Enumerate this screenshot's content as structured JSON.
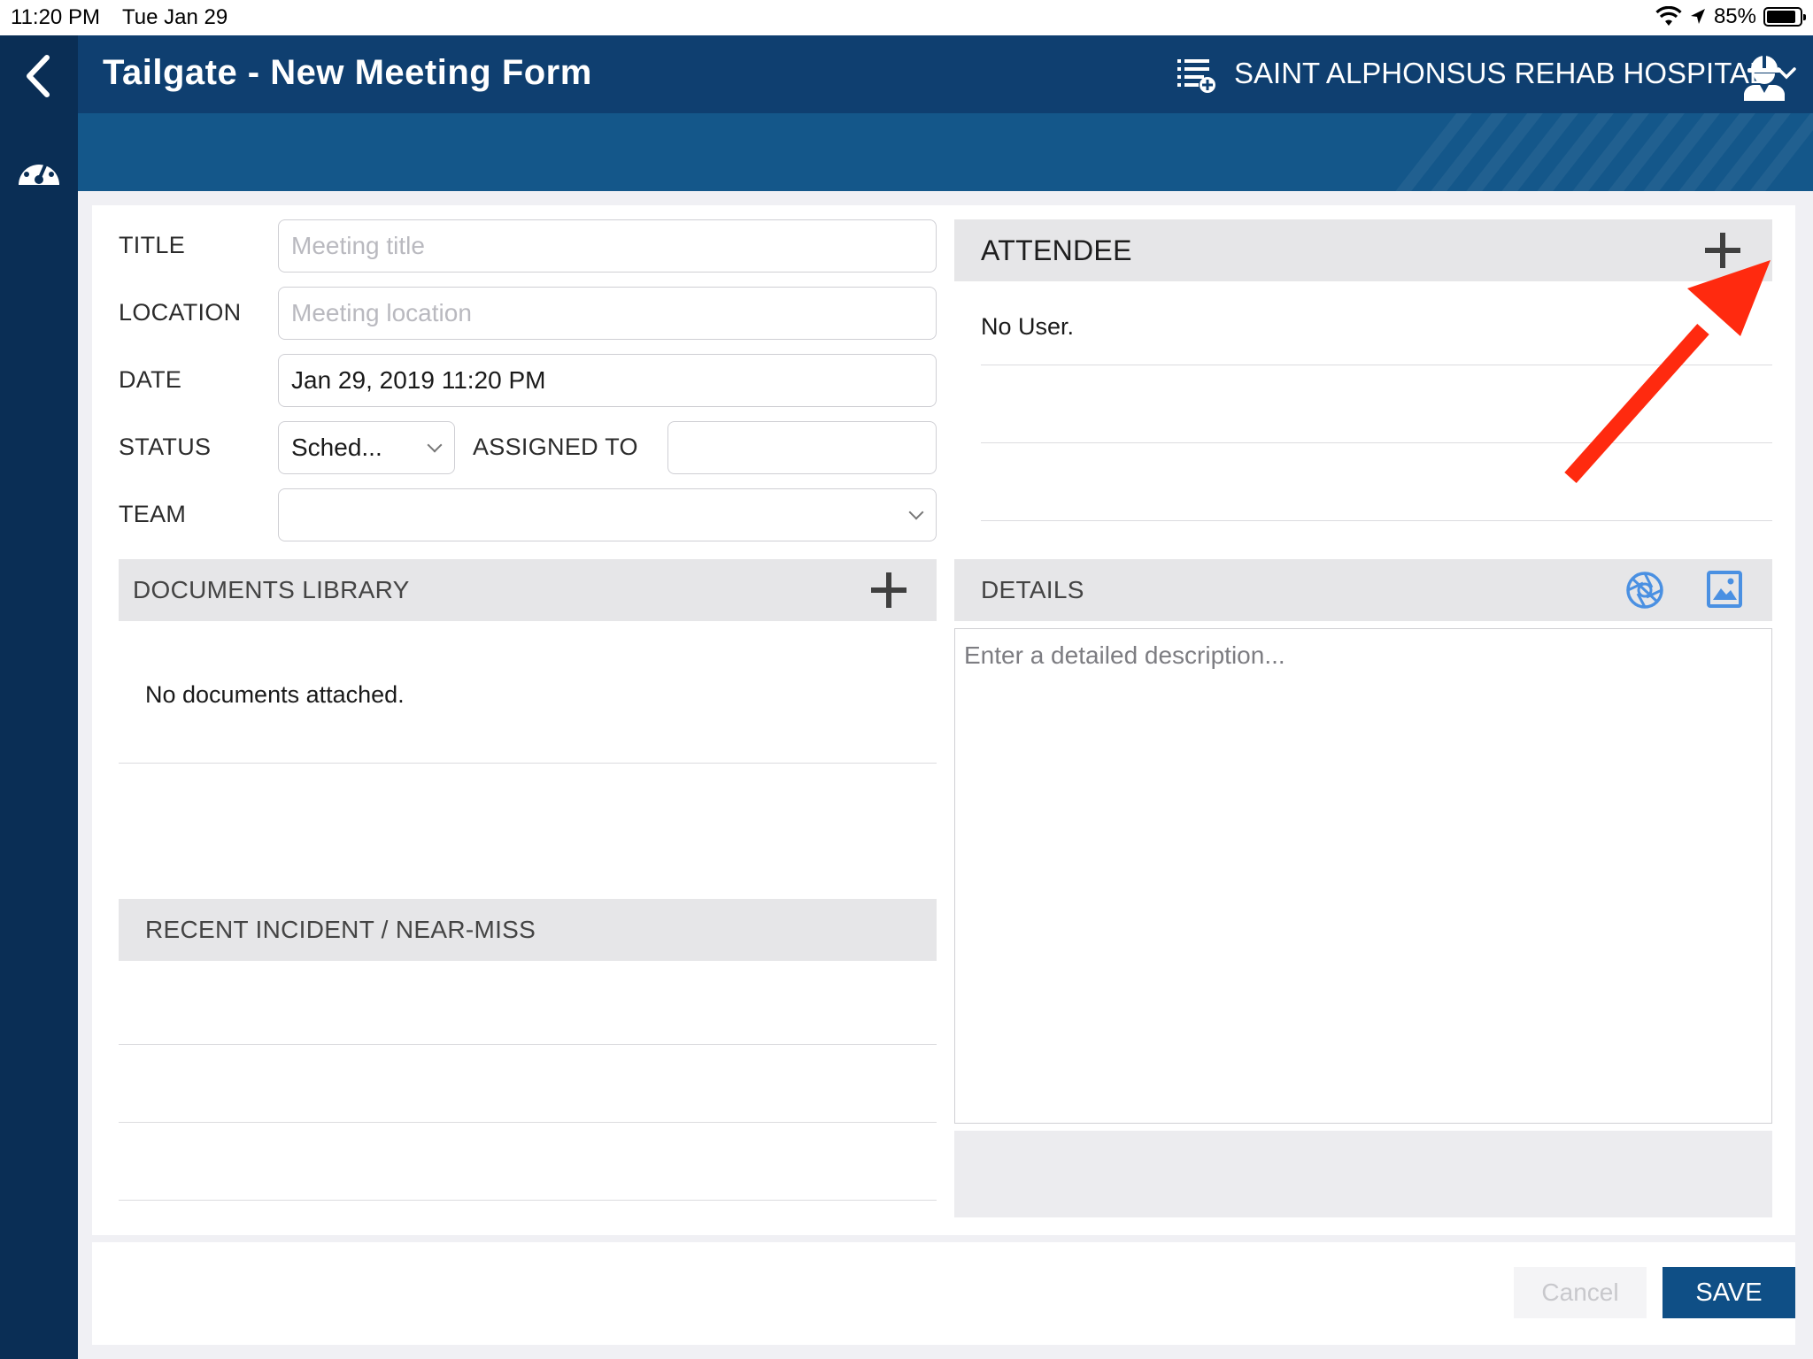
{
  "status_bar": {
    "time": "11:20 PM",
    "date": "Tue Jan 29",
    "battery": "85%"
  },
  "header": {
    "title": "Tailgate - New Meeting Form",
    "organization": "SAINT ALPHONSUS REHAB HOSPITAL"
  },
  "form": {
    "title_label": "TITLE",
    "title_placeholder": "Meeting title",
    "location_label": "LOCATION",
    "location_placeholder": "Meeting location",
    "date_label": "DATE",
    "date_value": "Jan 29, 2019 11:20 PM",
    "status_label": "STATUS",
    "status_value": "Sched...",
    "assigned_label": "ASSIGNED TO",
    "assigned_value": "",
    "team_label": "TEAM",
    "team_value": ""
  },
  "attendee": {
    "title": "ATTENDEE",
    "empty_text": "No User."
  },
  "documents": {
    "title": "DOCUMENTS LIBRARY",
    "empty_text": "No documents attached."
  },
  "incident": {
    "title": "RECENT INCIDENT / NEAR-MISS"
  },
  "details": {
    "title": "DETAILS",
    "placeholder": "Enter a detailed description..."
  },
  "footer": {
    "cancel_label": "Cancel",
    "save_label": "SAVE"
  },
  "icons": {
    "back": "chevron-left-icon",
    "dashboard": "speedometer-icon",
    "list": "list-add-icon",
    "org_dropdown": "chevron-down-icon",
    "profile": "worker-helmet-icon",
    "camera": "camera-aperture-icon",
    "gallery": "image-icon",
    "annotation": "red-arrow-icon"
  },
  "colors": {
    "nav_dark": "#0a2e55",
    "header": "#0f3f70",
    "sub_header": "#14578a",
    "accent_blue": "#4a90e2",
    "save_button": "#0f4f86",
    "arrow": "#ff2a0f"
  }
}
